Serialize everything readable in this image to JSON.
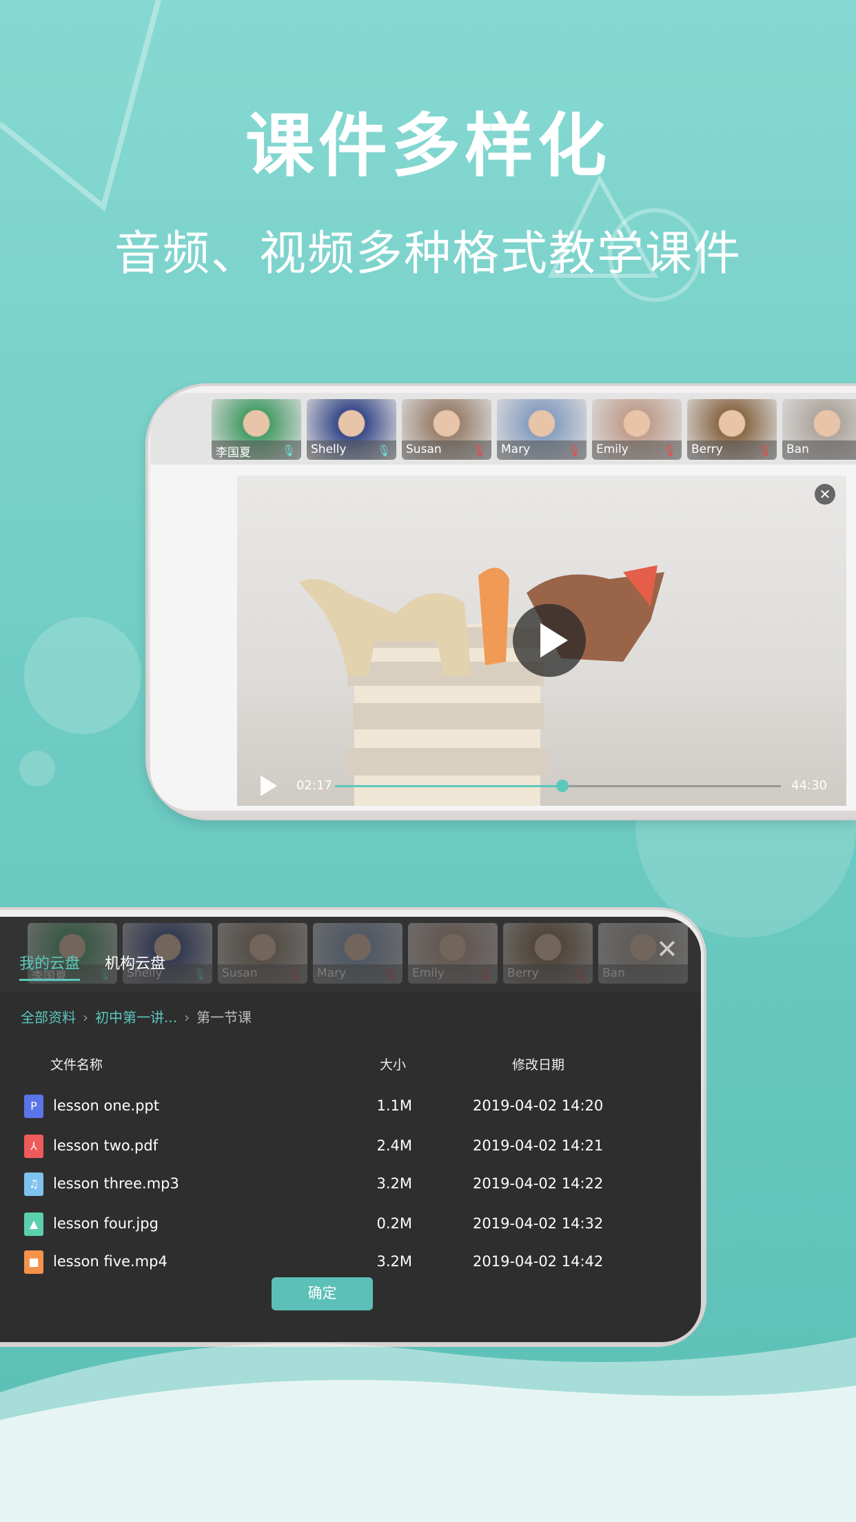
{
  "header": {
    "title": "课件多样化",
    "subtitle": "音频、视频多种格式教学课件"
  },
  "participants": [
    {
      "name": "李国夏",
      "mic": "on",
      "color": "#4a9e6a"
    },
    {
      "name": "Shelly",
      "mic": "on",
      "color": "#3a4b8a"
    },
    {
      "name": "Susan",
      "mic": "muted",
      "color": "#9a8270"
    },
    {
      "name": "Mary",
      "mic": "muted",
      "color": "#8aa0c0"
    },
    {
      "name": "Emily",
      "mic": "muted",
      "color": "#c0a090"
    },
    {
      "name": "Berry",
      "mic": "muted",
      "color": "#8a6a48"
    },
    {
      "name": "Ban",
      "mic": "none",
      "color": "#b0a8a0"
    }
  ],
  "video": {
    "current_time": "02:17",
    "total_time": "44:30",
    "progress_percent": 51,
    "accent": "#5cc7bd"
  },
  "cloud": {
    "tabs": [
      {
        "label": "我的云盘",
        "active": true
      },
      {
        "label": "机构云盘",
        "active": false
      }
    ],
    "breadcrumb": [
      "全部资料",
      "初中第一讲...",
      "第一节课"
    ],
    "columns": {
      "name": "文件名称",
      "size": "大小",
      "date": "修改日期"
    },
    "files": [
      {
        "name": "lesson one.ppt",
        "size": "1.1M",
        "date": "2019-04-02 14:20",
        "icon": "ppt-icon",
        "glyph": "P",
        "color": "#5b74e8"
      },
      {
        "name": "lesson two.pdf",
        "size": "2.4M",
        "date": "2019-04-02 14:21",
        "icon": "pdf-icon",
        "glyph": "⅄",
        "color": "#ef5a5a"
      },
      {
        "name": "lesson three.mp3",
        "size": "3.2M",
        "date": "2019-04-02 14:22",
        "icon": "audio-icon",
        "glyph": "♫",
        "color": "#7ec3ef"
      },
      {
        "name": "lesson four.jpg",
        "size": "0.2M",
        "date": "2019-04-02 14:32",
        "icon": "image-icon",
        "glyph": "▲",
        "color": "#5ccfae"
      },
      {
        "name": "lesson five.mp4",
        "size": "3.2M",
        "date": "2019-04-02 14:42",
        "icon": "video-icon",
        "glyph": "■",
        "color": "#f5924a"
      }
    ],
    "confirm_label": "确定"
  }
}
